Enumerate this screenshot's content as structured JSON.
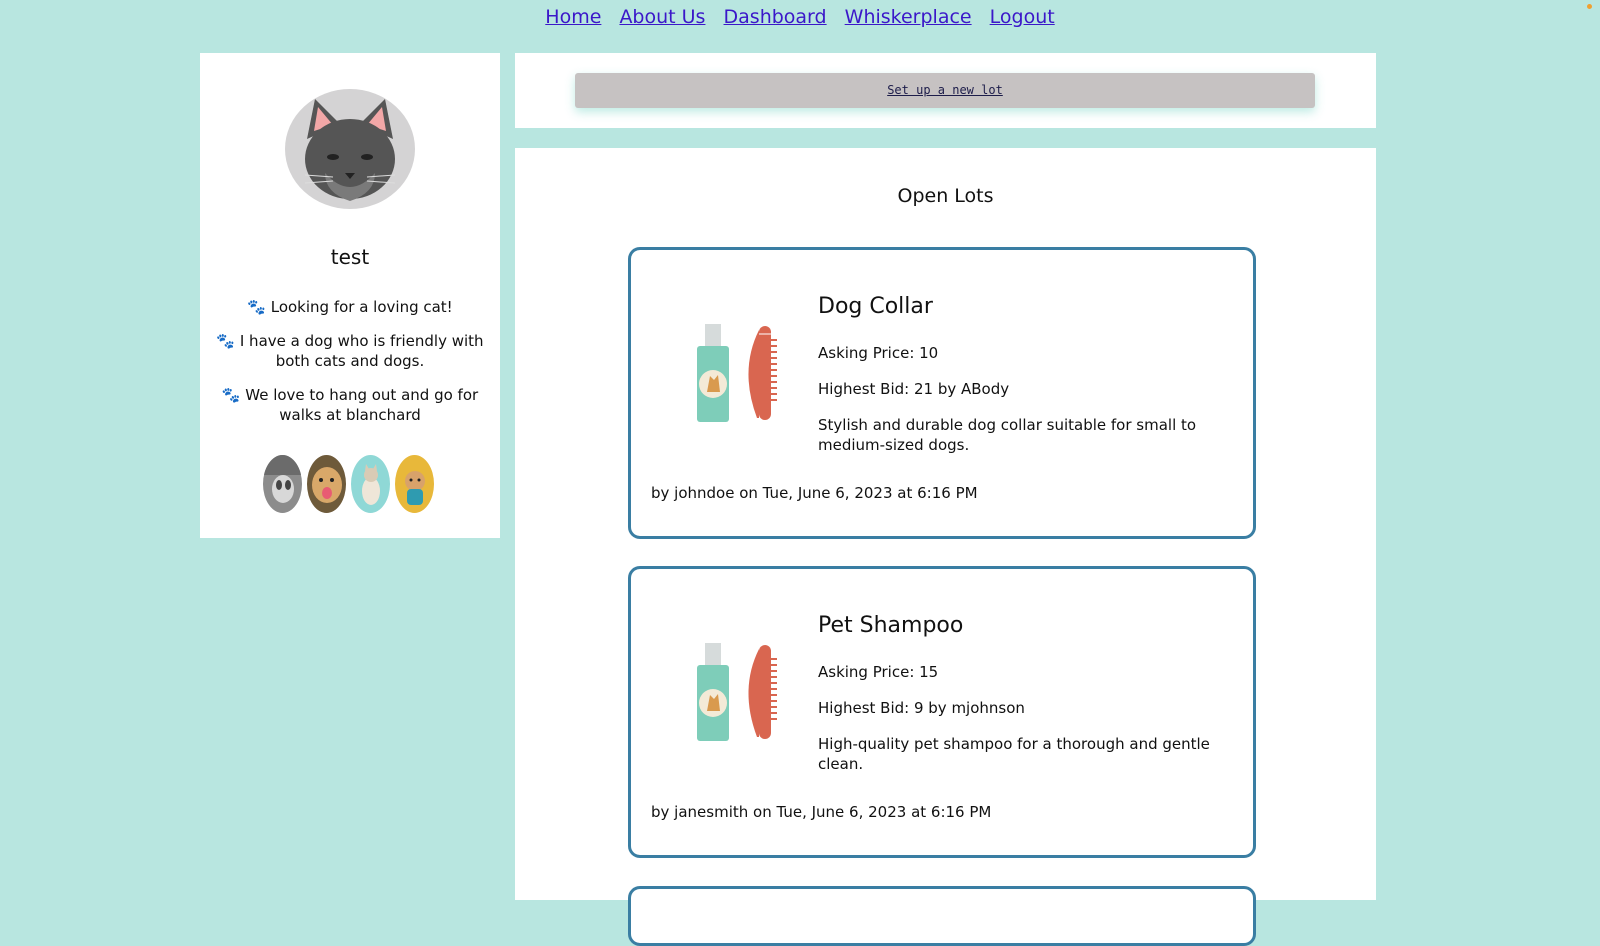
{
  "nav": {
    "home": "Home",
    "about": "About Us",
    "dashboard": "Dashboard",
    "whiskerplace": "Whiskerplace",
    "logout": "Logout"
  },
  "profile": {
    "username": "test",
    "bio": [
      "🐾 Looking for a loving cat!",
      "🐾 I have a dog who is friendly with both cats and dogs.",
      "🐾 We love to hang out and go for walks at blanchard"
    ],
    "avatar_icon": "cat-face-icon",
    "pet_photos": [
      "pet-photo-husky",
      "pet-photo-golden-retriever",
      "pet-photo-cat",
      "pet-photo-small-dog"
    ]
  },
  "actions": {
    "new_lot": "Set up a new lot"
  },
  "lots": {
    "heading": "Open Lots",
    "items": [
      {
        "title": "Dog Collar",
        "asking": "Asking Price: 10",
        "highest_bid": "Highest Bid: 21 by ABody",
        "description": "Stylish and durable dog collar suitable for small to medium-sized dogs.",
        "footer": "by johndoe on Tue, June 6, 2023 at 6:16 PM",
        "image_icon": "shampoo-and-comb-icon"
      },
      {
        "title": "Pet Shampoo",
        "asking": "Asking Price: 15",
        "highest_bid": "Highest Bid: 9 by mjohnson",
        "description": "High-quality pet shampoo for a thorough and gentle clean.",
        "footer": "by janesmith on Tue, June 6, 2023 at 6:16 PM",
        "image_icon": "shampoo-and-comb-icon"
      }
    ]
  },
  "colors": {
    "background": "#b8e6e0",
    "panel": "#ffffff",
    "card_border": "#3a7ea3",
    "link": "#3b17c9",
    "button": "#c6c2c2"
  }
}
